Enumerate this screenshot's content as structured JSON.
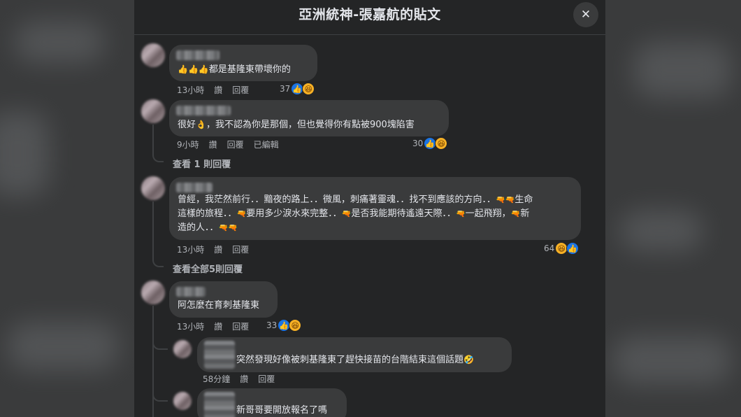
{
  "dialog": {
    "title": "亞洲統神-張嘉航的貼文",
    "close_label": "✕"
  },
  "colors": {
    "panel_bg": "#242526",
    "bubble_bg": "#3a3b3c",
    "like_blue": "#1b74e4",
    "haha_yellow": "#f7b125"
  },
  "comments": [
    {
      "text": "都是基隆東帶壞你的",
      "prefix_emoji": "👍👍👍",
      "time": "13小時",
      "like_label": "讚",
      "reply_label": "回覆",
      "reaction_count": "37"
    },
    {
      "text_before_emoji": "很好",
      "emoji": "👌",
      "text": "，我不認為你是那個，但也覺得你有點被900塊陷害",
      "time": "9小時",
      "like_label": "讚",
      "reply_label": "回覆",
      "edited_label": "已編輯",
      "reaction_count": "30",
      "view_replies": "查看 1 則回覆"
    },
    {
      "line1": "曾經，我茫然前行．．黯夜的路上．．微風，刺痛著靈魂．．找不到應該的方向．．",
      "line1_tail": "生命",
      "line2": "這樣的旅程．．",
      "line2_b": "要用多少淚水來完整．．",
      "line2_c": "是否我能期待遙遠天際．．",
      "line2_d": "一起飛翔，",
      "line2_e": "新",
      "line3": "造的人．．",
      "time": "13小時",
      "like_label": "讚",
      "reply_label": "回覆",
      "reaction_count": "64",
      "view_replies": "查看全部5則回覆"
    },
    {
      "text": "阿怎麼在育刺基隆東",
      "time": "13小時",
      "like_label": "讚",
      "reply_label": "回覆",
      "reaction_count": "33"
    }
  ],
  "replies": [
    {
      "text": "突然發現好像被刺基隆東了趕快接苗的台階結束這個話題",
      "emoji": "🤣",
      "time": "58分鐘",
      "like_label": "讚",
      "reply_label": "回覆"
    },
    {
      "text": "新哥哥要開放報名了嗎"
    }
  ]
}
